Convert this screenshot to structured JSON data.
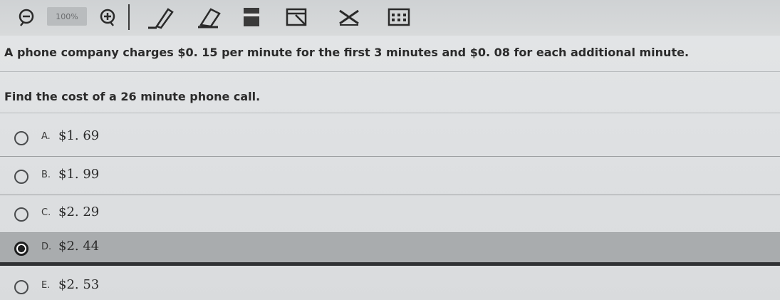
{
  "toolbar": {
    "zoom_level": "100%",
    "icons": [
      "zoom-out-icon",
      "zoom-in-icon",
      "pencil-icon",
      "eraser-icon",
      "highlighter-icon",
      "reference-icon",
      "close-icon",
      "calculator-icon"
    ]
  },
  "question": {
    "line1": "A phone company charges $0. 15 per minute for the first 3 minutes and $0. 08 for each additional minute.",
    "line2": "Find the cost of a 26 minute phone call."
  },
  "options": [
    {
      "letter": "A.",
      "value": "$1. 69",
      "selected": false
    },
    {
      "letter": "B.",
      "value": "$1. 99",
      "selected": false
    },
    {
      "letter": "C.",
      "value": "$2. 29",
      "selected": false
    },
    {
      "letter": "D.",
      "value": "$2. 44",
      "selected": true
    },
    {
      "letter": "E.",
      "value": "$2. 53",
      "selected": false
    }
  ],
  "colors": {
    "selected_row": "#a9acae",
    "text": "#2b2b2b"
  }
}
